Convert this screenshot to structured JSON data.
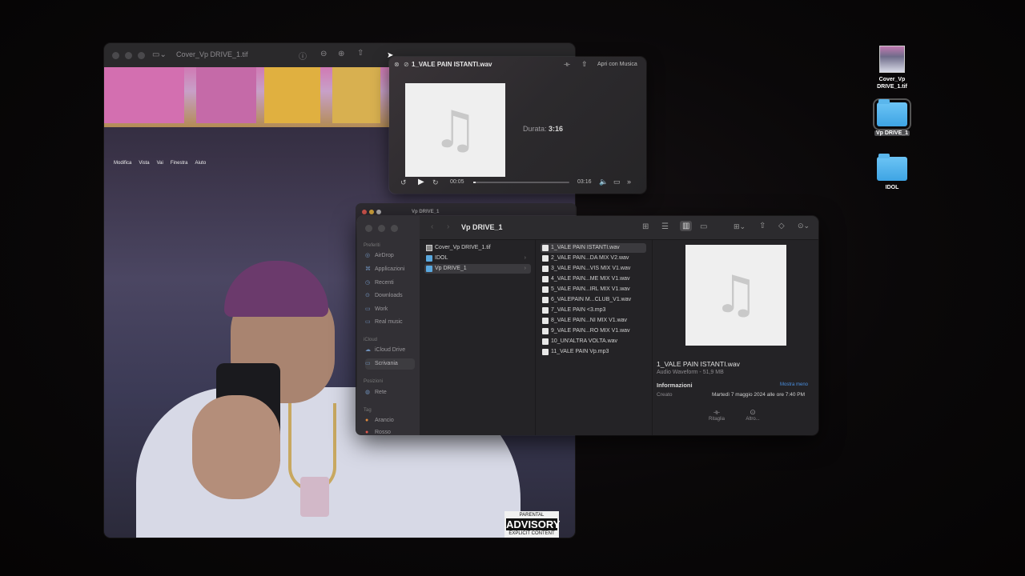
{
  "preview_window": {
    "title": "Cover_Vp DRIVE_1.tif",
    "photo_menu": [
      "Modifica",
      "Vista",
      "Vai",
      "Finestra",
      "Aiuto"
    ],
    "advisory": {
      "top": "PARENTAL",
      "mid": "ADVISORY",
      "bottom": "EXPLICIT CONTENT"
    }
  },
  "quicklook_audio": {
    "title": "1_VALE PAIN ISTANTI.wav",
    "open_with": "Apri con Musica",
    "duration_label": "Durata:",
    "duration_value": "3:16",
    "time_elapsed": "00:05",
    "time_total": "03:16",
    "progress_fraction": 0.026
  },
  "finder_ghost": {
    "title": "Vp DRIVE_1"
  },
  "finder": {
    "title": "Vp DRIVE_1",
    "sidebar": {
      "favorites_header": "Preferiti",
      "favorites": [
        {
          "label": "AirDrop",
          "icon": "airdrop-icon"
        },
        {
          "label": "Applicazioni",
          "icon": "apps-icon"
        },
        {
          "label": "Recenti",
          "icon": "clock-icon"
        },
        {
          "label": "Downloads",
          "icon": "download-icon"
        },
        {
          "label": "Work",
          "icon": "folder-icon"
        },
        {
          "label": "Real music",
          "icon": "folder-icon"
        }
      ],
      "icloud_header": "iCloud",
      "icloud": [
        {
          "label": "iCloud Drive",
          "icon": "cloud-icon"
        },
        {
          "label": "Scrivania",
          "icon": "desktop-icon"
        }
      ],
      "locations_header": "Posizioni",
      "locations": [
        {
          "label": "Rete",
          "icon": "globe-icon"
        }
      ],
      "tags_header": "Tag",
      "tags": [
        {
          "label": "Arancio"
        },
        {
          "label": "Rosso"
        }
      ]
    },
    "column1": [
      {
        "label": "Cover_Vp DRIVE_1.tif",
        "kind": "img"
      },
      {
        "label": "IDOL",
        "kind": "folder"
      },
      {
        "label": "Vp DRIVE_1",
        "kind": "folder",
        "selected": true
      }
    ],
    "column2": [
      "1_VALE PAIN ISTANTI.wav",
      "2_VALE PAIN...DA MIX V2.wav",
      "3_VALE PAIN...VIS MIX V1.wav",
      "4_VALE PAIN...ME MIX V1.wav",
      "5_VALE PAIN...IRL MIX V1.wav",
      "6_VALEPAIN M...CLUB_V1.wav",
      "7_VALE PAIN <3.mp3",
      "8_VALE PAIN...NI MIX V1.wav",
      "9_VALE PAIN...RO MIX V1.wav",
      "10_UN'ALTRA VOLTA.wav",
      "11_VALE PAIN Vp.mp3"
    ],
    "preview": {
      "name": "1_VALE PAIN ISTANTI.wav",
      "kind": "Audio Waveform - 51,9 MB",
      "info_header": "Informazioni",
      "show_less": "Mostra meno",
      "created_label": "Creato",
      "created_value": "Martedì 7 maggio 2024 alle ore 7:40 PM",
      "action_trim": "Ritaglia",
      "action_more": "Altro..."
    }
  },
  "desktop": {
    "icons": [
      {
        "label": "Cover_Vp DRIVE_1.tif"
      },
      {
        "label": "Vp DRIVE_1"
      },
      {
        "label": "IDOL"
      }
    ]
  },
  "colors": {
    "accent": "#4a90e2",
    "folder": "#5aa8de"
  }
}
